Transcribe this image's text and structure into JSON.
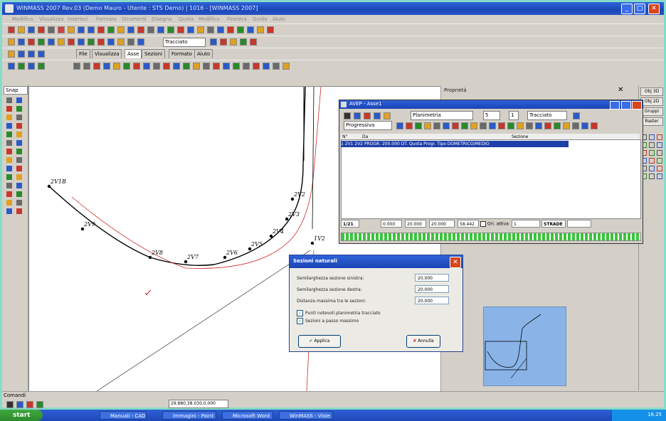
{
  "window": {
    "title": "WINMASS 2007 Rev.03 (Demo Mauro - Utente : STS Demo) | 1016 - [WINMASS 2007]",
    "min": "_",
    "max": "□",
    "close": "✕"
  },
  "menu": [
    "Modifica",
    "Visualizza",
    "Inserisci",
    "Formato",
    "Strumenti",
    "Disegna",
    "Quota",
    "Modifica",
    "Finestra",
    "Guida",
    "Aiuto"
  ],
  "toolbar": {
    "layer_combo": "Tracciato",
    "tabs": [
      "File",
      "Visualizza",
      "Asse",
      "Sezioni",
      "Formato",
      "Aiuto"
    ],
    "active_tab": "Asse"
  },
  "left_panel": {
    "header": "Snap"
  },
  "drawing": {
    "vertices": [
      {
        "label": "2V1B"
      },
      {
        "label": "2V9"
      },
      {
        "label": "2V8"
      },
      {
        "label": "2V7"
      },
      {
        "label": "2V6"
      },
      {
        "label": "2V5"
      },
      {
        "label": "2V4"
      },
      {
        "label": "2V3"
      },
      {
        "label": "2V2"
      },
      {
        "label": "1V2"
      }
    ]
  },
  "right_panel": {
    "header": "Proprietà",
    "close": "✕"
  },
  "far_right": {
    "buttons": [
      "Obj 3D",
      "Obj 2D",
      "Gruppi",
      "Raster"
    ]
  },
  "grid_window": {
    "title": "AVEP - Asse1",
    "combo_planimetria": "Planimetria",
    "combo_progressive": "Progressiva",
    "combo_val_a": "5",
    "combo_val_b": "1",
    "combo_type": "Tracciato",
    "col_headers": [
      "N°",
      "Da",
      "Sezione"
    ],
    "selected_row": "1  2V1   2V2   PROGR.  200.000   DT.  Quota  Progr.  Tipo  DOMETRICO/MEDIO",
    "row_count_label": "1/21",
    "footer_fields": [
      "0.000",
      "20.000",
      "20.000",
      "58.442"
    ],
    "checkbox_label": "Ori. attiva",
    "footer_field_last": "1",
    "status_field": "STRADE",
    "progress": 100
  },
  "dialog": {
    "title": "Sezioni naturali",
    "fields": [
      {
        "label": "Semilarghezza sezione sinistra:",
        "value": "20.000"
      },
      {
        "label": "Semilarghezza sezione destra:",
        "value": "20.000"
      },
      {
        "label": "Distanza massima tra le sezioni:",
        "value": "20.000"
      }
    ],
    "checkboxes": [
      {
        "label": "Punti notevoli planimetria tracciato",
        "checked": true
      },
      {
        "label": "Sezioni a passo massimo",
        "checked": true
      }
    ],
    "apply": "Applica",
    "cancel": "Annulla"
  },
  "command": {
    "label": "Comandi",
    "status_combo": "29.880,38.030,0.000"
  },
  "taskbar": {
    "start": "start",
    "tasks": [
      "Manuali - CAD",
      "Immagini - Paint",
      "Microsoft Word",
      "WinMASS - Viste"
    ],
    "clock": "16.25"
  },
  "colors": {
    "titlebar": "#1c46b6",
    "canvas": "#ffffff",
    "chrome": "#d4d0c8",
    "preview_bg": "#8ab4e8",
    "dialog_close": "#d8461c"
  }
}
